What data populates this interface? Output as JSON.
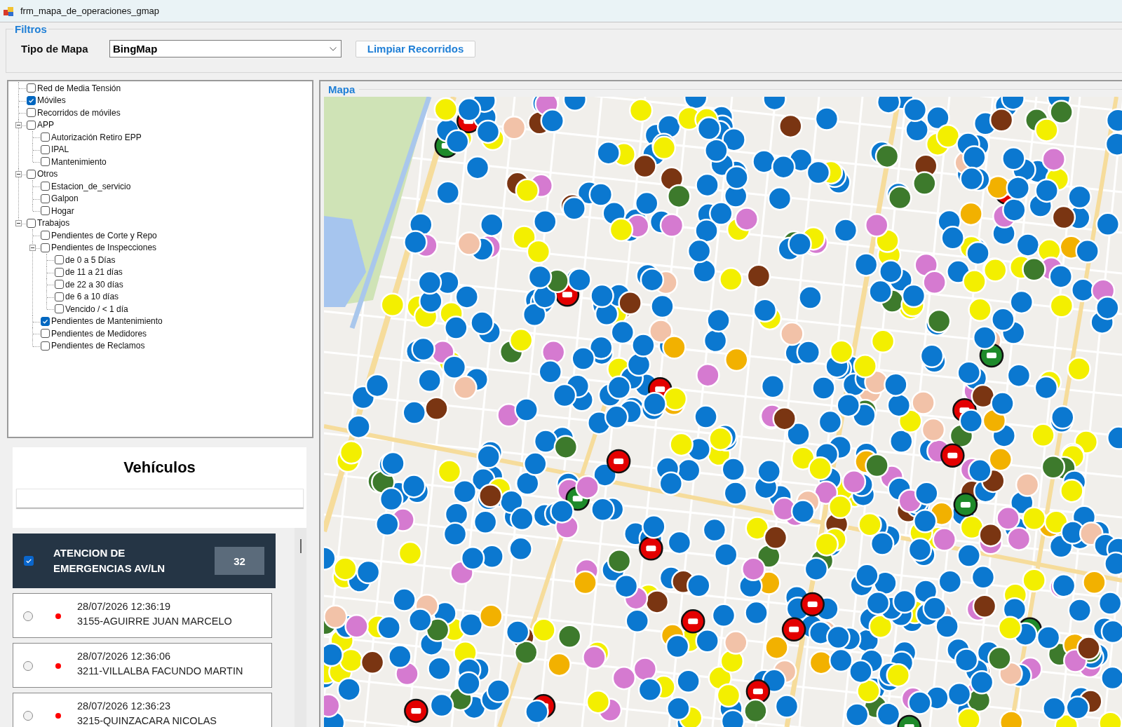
{
  "window": {
    "title": "frm_mapa_de_operaciones_gmap"
  },
  "filters": {
    "title": "Filtros",
    "map_type": {
      "label": "Tipo de Mapa",
      "value": "BingMap"
    },
    "buttons": [
      "Limpiar Recorridos"
    ]
  },
  "tree": {
    "items": [
      {
        "label": "Red de Media Tensión",
        "checked": false
      },
      {
        "label": "Móviles",
        "checked": true
      },
      {
        "label": "Recorridos de móviles",
        "checked": false
      },
      {
        "label": "APP",
        "checked": false,
        "expanded": true,
        "children": [
          {
            "label": "Autorización Retiro EPP",
            "checked": false
          },
          {
            "label": "IPAL",
            "checked": false
          },
          {
            "label": "Mantenimiento",
            "checked": false
          }
        ]
      },
      {
        "label": "Otros",
        "checked": false,
        "expanded": true,
        "children": [
          {
            "label": "Estacion_de_servicio",
            "checked": false
          },
          {
            "label": "Galpon",
            "checked": false
          },
          {
            "label": "Hogar",
            "checked": false
          }
        ]
      },
      {
        "label": "Trabajos",
        "checked": false,
        "expanded": true,
        "children": [
          {
            "label": "Pendientes de Corte y Repo",
            "checked": false
          },
          {
            "label": "Pendientes de Inspecciones",
            "checked": false,
            "expanded": true,
            "children": [
              {
                "label": "de 0 a 5 Días",
                "checked": false
              },
              {
                "label": "de 11 a 21 días",
                "checked": false
              },
              {
                "label": "de 22 a 30 días",
                "checked": false
              },
              {
                "label": "de 6 a 10 días",
                "checked": false
              },
              {
                "label": "Vencido / < 1 día",
                "checked": false
              }
            ]
          },
          {
            "label": "Pendientes de Mantenimiento",
            "checked": true
          },
          {
            "label": "Pendientes de Medidores",
            "checked": false
          },
          {
            "label": "Pendientes de Reclamos",
            "checked": false
          }
        ]
      }
    ]
  },
  "vehicles": {
    "title": "Vehículos",
    "groups": [
      {
        "name": "ATENCION DE EMERGENCIAS AV/LN",
        "checked": true,
        "count": "32",
        "items": [
          {
            "selected": false,
            "color": "#ff0000",
            "time": "28/07/2026 12:36:19",
            "name": "3155-AGUIRRE JUAN MARCELO"
          },
          {
            "selected": false,
            "color": "#ff0000",
            "time": "28/07/2026 12:36:06",
            "name": "3211-VILLALBA FACUNDO MARTIN"
          },
          {
            "selected": false,
            "color": "#ff0000",
            "time": "28/07/2026 12:36:23",
            "name": "3215-QUINZACARA NICOLAS"
          }
        ]
      }
    ]
  },
  "map": {
    "title": "Mapa"
  }
}
